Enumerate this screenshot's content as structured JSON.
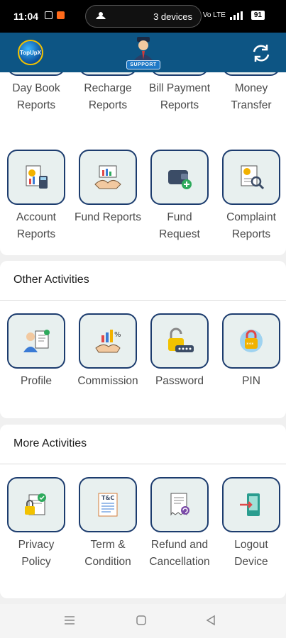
{
  "status_bar": {
    "time": "11:04",
    "devices_label": "3 devices",
    "network_label": "Vo LTE",
    "battery": "91"
  },
  "header": {
    "logo_text": "TopUpX",
    "support_badge": "SUPPORT"
  },
  "report_tiles": [
    {
      "label": "Day Book Reports",
      "icon": "day-book-icon"
    },
    {
      "label": "Recharge Reports",
      "icon": "recharge-icon"
    },
    {
      "label": "Bill Payment Reports",
      "icon": "bill-icon"
    },
    {
      "label": "Money Transfer",
      "icon": "money-transfer-icon"
    },
    {
      "label": "Account Reports",
      "icon": "account-reports-icon"
    },
    {
      "label": "Fund Reports",
      "icon": "fund-reports-icon"
    },
    {
      "label": "Fund Request",
      "icon": "fund-request-icon"
    },
    {
      "label": "Complaint Reports",
      "icon": "complaint-reports-icon"
    }
  ],
  "other_activities": {
    "title": "Other Activities",
    "items": [
      {
        "label": "Profile",
        "icon": "profile-icon"
      },
      {
        "label": "Commission",
        "icon": "commission-icon"
      },
      {
        "label": "Password",
        "icon": "password-lock-icon"
      },
      {
        "label": "PIN",
        "icon": "pin-lock-icon"
      }
    ]
  },
  "more_activities": {
    "title": "More Activities",
    "items": [
      {
        "label": "Privacy Policy",
        "icon": "privacy-policy-icon"
      },
      {
        "label": "Term & Condition",
        "icon": "terms-icon"
      },
      {
        "label": "Refund and Cancellation",
        "icon": "refund-icon"
      },
      {
        "label": "Logout Device",
        "icon": "logout-device-icon"
      }
    ]
  },
  "colors": {
    "header": "#0d5584",
    "tile_border": "#1c3c6e",
    "tile_bg": "#e8f0ef"
  }
}
